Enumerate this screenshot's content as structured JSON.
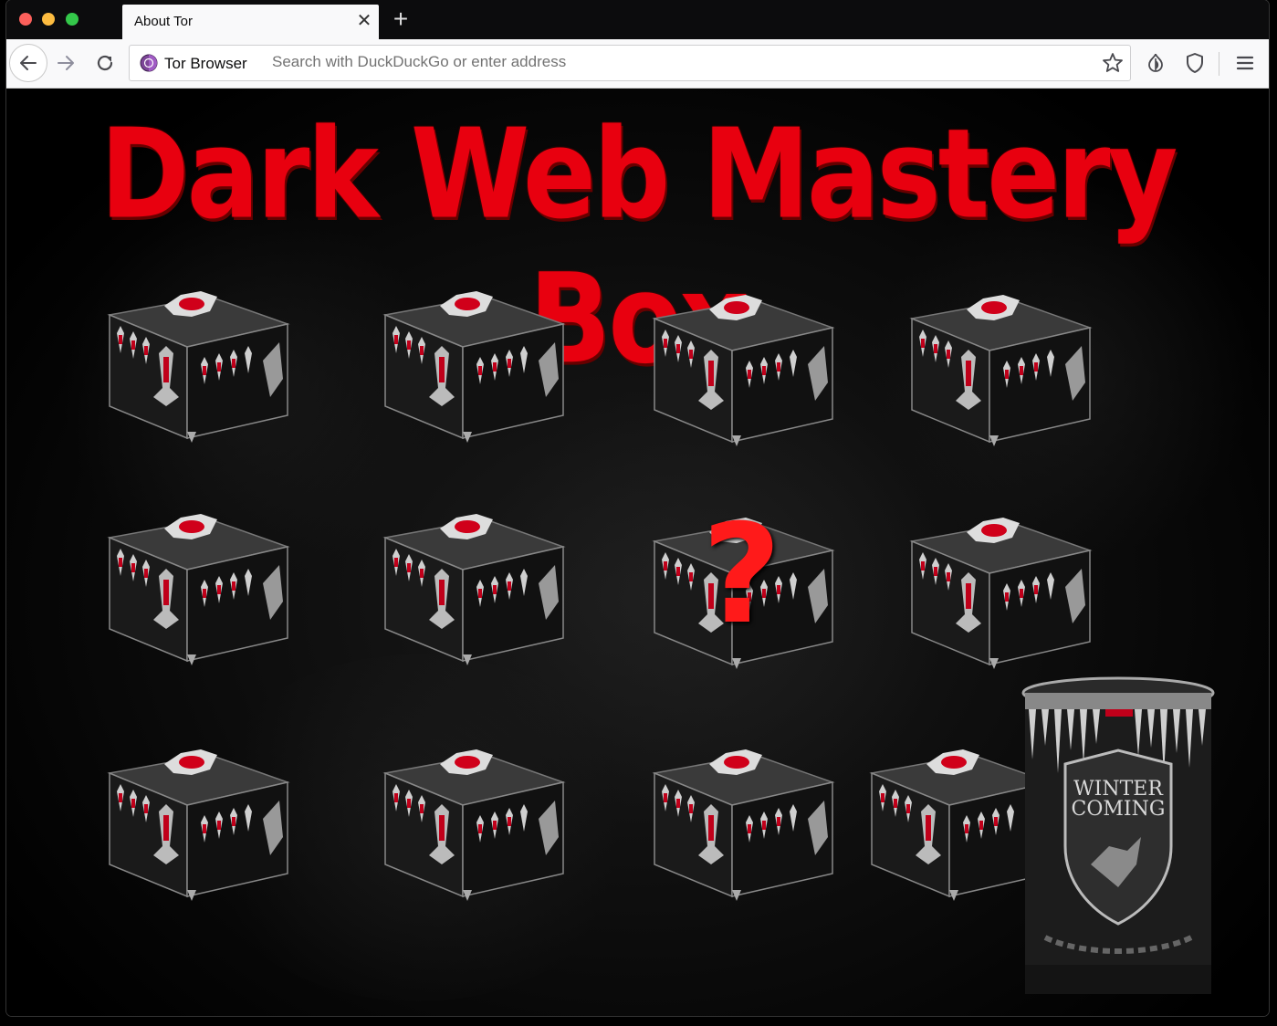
{
  "window": {
    "tab_title": "About Tor",
    "close_tab": "✕",
    "new_tab": "+"
  },
  "toolbar": {
    "site_label": "Tor Browser",
    "url_placeholder": "Search with DuckDuckGo or enter address"
  },
  "page": {
    "headline": "Dark Web Mastery Box",
    "mystery_mark": "?",
    "tankard_line1": "WINTER",
    "tankard_line2": "COMING",
    "accent_color": "#e8000f"
  }
}
